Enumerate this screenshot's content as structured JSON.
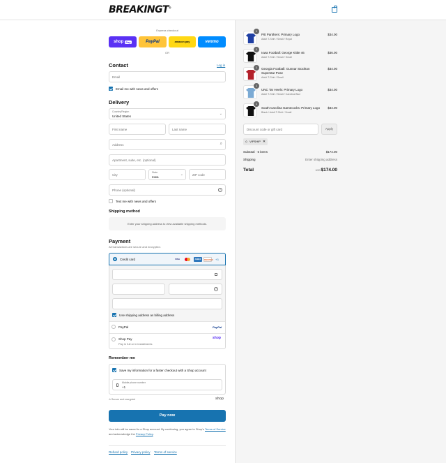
{
  "header": {
    "brand": "BREAKINGT",
    "brand_mark": "®"
  },
  "express": {
    "title": "Express checkout",
    "buttons": {
      "shop": "shop",
      "shop_pay_badge": "Pay",
      "paypal": "PayPal",
      "amazon": "amazon pay",
      "venmo": "venmo"
    },
    "or": "OR"
  },
  "contact": {
    "title": "Contact",
    "login": "Log in",
    "email_placeholder": "Email",
    "news_label": "Email me with news and offers"
  },
  "delivery": {
    "title": "Delivery",
    "country_label": "Country/Region",
    "country_value": "United States",
    "first_name": "First name",
    "last_name": "Last name",
    "address": "Address",
    "apartment": "Apartment, suite, etc. (optional)",
    "city": "City",
    "state_label": "State",
    "state_value": "Iowa",
    "zip": "ZIP code",
    "phone": "Phone (optional)",
    "text_news": "Text me with news and offers"
  },
  "shipping": {
    "title": "Shipping method",
    "notice": "Enter your shipping address to view available shipping methods."
  },
  "payment": {
    "title": "Payment",
    "subtitle": "All transactions are secure and encrypted.",
    "credit_card": "Credit card",
    "card_logos": [
      "VISA",
      "MC",
      "AMEX",
      "DISCOVER"
    ],
    "more_cards": "+3",
    "billing_label": "Use shipping address as billing address",
    "paypal": "PayPal",
    "paypal_logo": "PayPal",
    "shop_pay": "Shop Pay",
    "shop_pay_sub": "Pay in full or in installments",
    "shop_logo": "shop"
  },
  "remember": {
    "title": "Remember me",
    "save_label": "Save my information for a faster checkout with a Shop account",
    "mobile_label": "Mobile phone number",
    "mobile_value": "+1",
    "secure": "Secure and encrypted",
    "shop_logo": "shop"
  },
  "pay_now": "Pay now",
  "legal": {
    "text1": "Your info will be saved to a Shop account. By continuing, you agree to Shop's",
    "terms": "Terms of Service",
    "text2": " and acknowledge the ",
    "privacy": "Privacy Policy",
    "text3": "."
  },
  "footer": {
    "refund": "Refund policy",
    "privacy": "Privacy policy",
    "terms": "Terms of service"
  },
  "order": {
    "items": [
      {
        "name": "Pitt Panthers: Primary Logo",
        "variant": "Adult T-Shirt / Small / Royal",
        "price": "$34.00",
        "qty": "1",
        "color": "#1f3fa3"
      },
      {
        "name": "Iowa Football: George Kittle 46",
        "variant": "Adult T-Shirt / Small / Small",
        "price": "$36.00",
        "qty": "1",
        "color": "#111111"
      },
      {
        "name": "Georgia Football: Gunnar Stockton Superstar Pose",
        "variant": "Adult T-Shirt / Small",
        "price": "$34.00",
        "qty": "1",
        "color": "#b3202a"
      },
      {
        "name": "UNC Tar Heels: Primary Logo",
        "variant": "Adult T-Shirt / Small / Carolina Blue",
        "price": "$34.00",
        "qty": "1",
        "color": "#7baad4"
      },
      {
        "name": "South Carolina Gamecocks: Primary Logo",
        "variant": "Black / Adult T-Shirt / Small",
        "price": "$34.00",
        "qty": "1",
        "color": "#111111"
      }
    ],
    "discount_placeholder": "Discount code or gift card",
    "apply": "Apply",
    "code": "VIPSHIP",
    "subtotal_label": "Subtotal · 5 items",
    "subtotal_value": "$174.00",
    "shipping_label": "Shipping",
    "shipping_value": "Enter shipping address",
    "total_label": "Total",
    "currency": "USD",
    "total_value": "$174.00"
  }
}
